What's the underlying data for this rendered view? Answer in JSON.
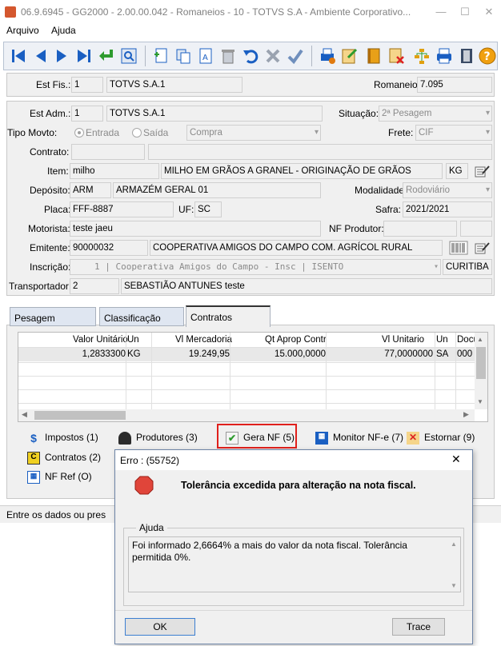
{
  "window": {
    "title": "06.9.6945 - GG2000 - 2.00.00.042 - Romaneios - 10 - TOTVS S.A - Ambiente Corporativo...",
    "minimize": "—",
    "maximize": "☐",
    "close": "✕"
  },
  "menu": {
    "items": [
      "Arquivo",
      "Ajuda"
    ]
  },
  "header": {
    "est_fis_label": "Est Fis.:",
    "est_fis_code": "1",
    "est_fis_name": "TOTVS S.A.1",
    "romaneio_label": "Romaneio:",
    "romaneio_value": "7.095"
  },
  "form": {
    "est_adm_label": "Est Adm.:",
    "est_adm_code": "1",
    "est_adm_name": "TOTVS S.A.1",
    "situacao_label": "Situação:",
    "situacao_value": "2ª Pesagem",
    "tipo_movto_label": "Tipo Movto:",
    "entrada_label": "Entrada",
    "saida_label": "Saída",
    "tipo_value": "Compra",
    "frete_label": "Frete:",
    "frete_value": "CIF",
    "contrato_label": "Contrato:",
    "item_label": "Item:",
    "item_code": "milho",
    "item_desc": "MILHO EM GRÃOS A GRANEL - ORIGINAÇÃO DE GRÃOS",
    "item_unit": "KG",
    "deposito_label": "Depósito:",
    "deposito_code": "ARM",
    "deposito_name": "ARMAZÉM GERAL 01",
    "modalidade_label": "Modalidade:",
    "modalidade_value": "Rodoviário",
    "placa_label": "Placa:",
    "placa_value": "FFF-8887",
    "uf_label": "UF:",
    "uf_value": "SC",
    "safra_label": "Safra:",
    "safra_value": "2021/2021",
    "motorista_label": "Motorista:",
    "motorista_value": "teste jaeu",
    "nf_produtor_label": "NF Produtor:",
    "emitente_label": "Emitente:",
    "emitente_code": "90000032",
    "emitente_name": "COOPERATIVA AMIGOS DO CAMPO COM. AGRÍCOL RURAL",
    "inscricao_label": "Inscrição:",
    "inscricao_value": "1 | Cooperativa Amigos do Campo - Insc | ISENTO",
    "inscricao_city": "CURITIBA",
    "transportador_label": "Transportador:",
    "transportador_code": "2",
    "transportador_name": "SEBASTIÃO ANTUNES teste"
  },
  "tabs": [
    "Pesagem",
    "Classificação",
    "Contratos"
  ],
  "grid": {
    "headers": [
      "Valor Unitário",
      "Un",
      "Vl Mercadoria",
      "Qt Aprop Contr",
      "Vl Unitario",
      "Un",
      "Docu"
    ],
    "row": [
      "1,2833300",
      "KG",
      "19.249,95",
      "15.000,0000",
      "77,0000000",
      "SA",
      "000"
    ]
  },
  "actions": {
    "impostos": "Impostos (1)",
    "produtores": "Produtores (3)",
    "gera_nf": "Gera NF (5)",
    "monitor_nfe": "Monitor NF-e (7)",
    "estornar": "Estornar (9)",
    "contratos": "Contratos (2)",
    "nf_ref": "NF Ref (O)"
  },
  "status_bar": {
    "text": "Entre os dados ou pres"
  },
  "dialog": {
    "title": "Erro : (55752)",
    "message": "Tolerância excedida para alteração na nota fiscal.",
    "help_label": "Ajuda",
    "help_text": "Foi informado 2,6664% a mais do valor da nota fiscal. Tolerância permitida 0%.",
    "ok_label": "OK",
    "trace_label": "Trace",
    "close": "✕"
  },
  "colors": {
    "accent_blue": "#1a5fc2",
    "highlight_red": "#e0201c",
    "selected_row": "#e8e8e8",
    "help_icon": "#f0a010"
  }
}
